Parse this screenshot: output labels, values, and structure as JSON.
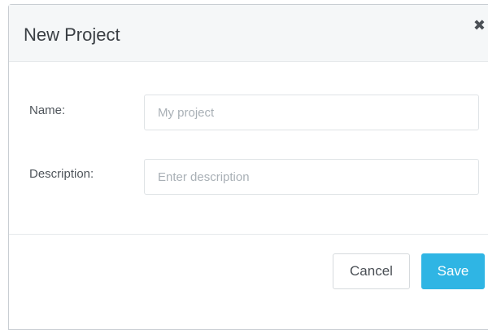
{
  "dialog": {
    "title": "New Project",
    "close_glyph": "✖",
    "close_icon": "close-icon"
  },
  "form": {
    "name": {
      "label": "Name:",
      "value": "",
      "placeholder": "My project"
    },
    "description": {
      "label": "Description:",
      "value": "",
      "placeholder": "Enter description"
    }
  },
  "footer": {
    "cancel_label": "Cancel",
    "save_label": "Save"
  },
  "colors": {
    "accent": "#2fb5e4",
    "header_bg": "#f5f7f8",
    "border": "#c9ced3"
  }
}
